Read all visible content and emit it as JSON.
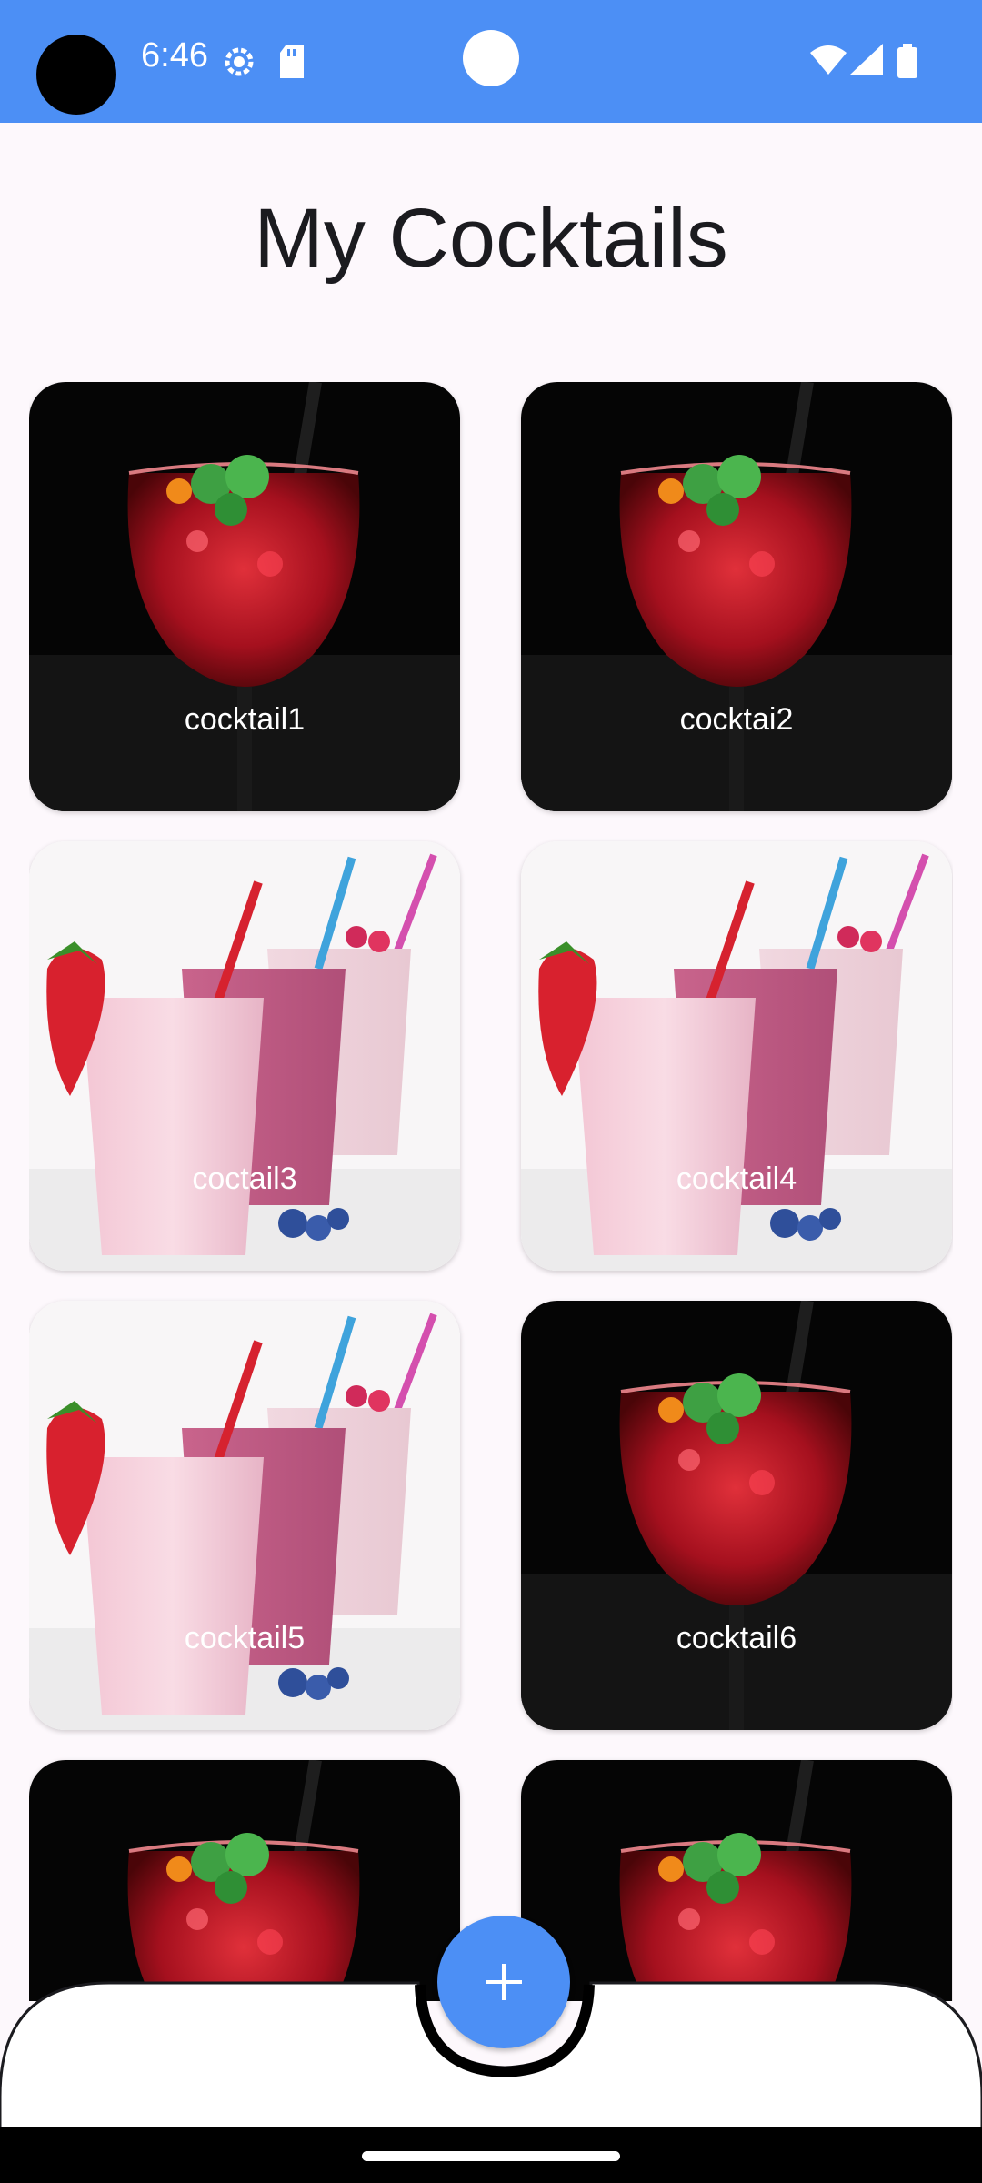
{
  "status_bar": {
    "time": "6:46",
    "background": "#4c8ff5",
    "icons": [
      "settings-icon",
      "sd-card-icon",
      "wifi-icon",
      "signal-icon",
      "battery-icon"
    ]
  },
  "title": "My Cocktails",
  "cocktails": [
    {
      "label": "cocktail1",
      "image": "red-cocktail"
    },
    {
      "label": "cocktai2",
      "image": "red-cocktail"
    },
    {
      "label": "coctail3",
      "image": "smoothies"
    },
    {
      "label": "cocktail4",
      "image": "smoothies"
    },
    {
      "label": "cocktail5",
      "image": "smoothies"
    },
    {
      "label": "cocktail6",
      "image": "red-cocktail"
    },
    {
      "label": "",
      "image": "red-cocktail"
    },
    {
      "label": "",
      "image": "red-cocktail"
    }
  ],
  "fab": {
    "icon": "plus-icon",
    "color": "#4c8ff5"
  }
}
